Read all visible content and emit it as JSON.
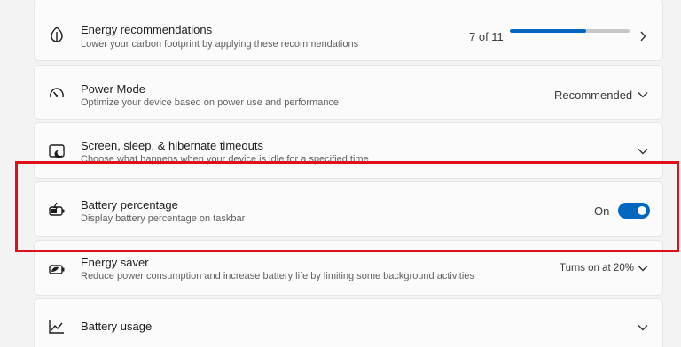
{
  "settings": {
    "energy_recommendations": {
      "title": "Energy recommendations",
      "description": "Lower your carbon footprint by applying these recommendations",
      "progress_text": "7 of 11",
      "progress_value": 7,
      "progress_total": 11
    },
    "power_mode": {
      "title": "Power Mode",
      "description": "Optimize your device based on power use and performance",
      "value": "Recommended"
    },
    "screen_sleep": {
      "title": "Screen, sleep, & hibernate timeouts",
      "description": "Choose what happens when your device is idle for a specified time"
    },
    "battery_percentage": {
      "title": "Battery percentage",
      "description": "Display battery percentage on taskbar",
      "state_label": "On",
      "enabled": true
    },
    "energy_saver": {
      "title": "Energy saver",
      "description": "Reduce power consumption and increase battery life by limiting some background activities",
      "value": "Turns on at 20%"
    },
    "battery_usage": {
      "title": "Battery usage"
    }
  },
  "colors": {
    "accent": "#0067c0",
    "highlight": "#e0101a"
  },
  "icons": {
    "energy_recommendations": "leaf-icon",
    "power_mode": "gauge-icon",
    "screen_sleep": "moon-screen-icon",
    "battery_percentage": "battery-charging-icon",
    "energy_saver": "battery-saver-icon",
    "battery_usage": "chart-line-icon"
  }
}
